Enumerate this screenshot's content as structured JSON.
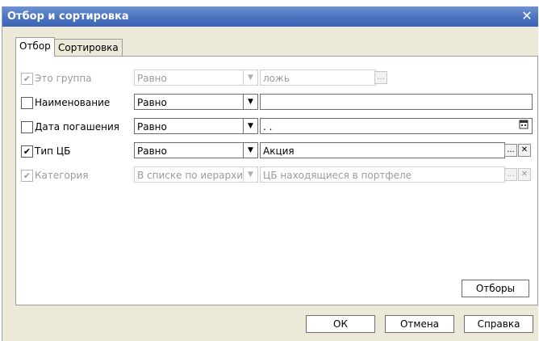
{
  "window": {
    "title": "Отбор и сортировка",
    "close_glyph": "✕"
  },
  "tabs": [
    {
      "label": "Отбор",
      "active": true
    },
    {
      "label": "Сортировка",
      "active": false
    }
  ],
  "filters": [
    {
      "label": "Это группа",
      "checked": true,
      "enabled": false,
      "condition": "Равно",
      "value": "ложь"
    },
    {
      "label": "Наименование",
      "checked": false,
      "enabled": true,
      "condition": "Равно",
      "value": ""
    },
    {
      "label": "Дата погашения",
      "checked": false,
      "enabled": true,
      "condition": "Равно",
      "value": " .  . "
    },
    {
      "label": "Тип ЦБ",
      "checked": true,
      "enabled": true,
      "condition": "Равно",
      "value": "Акция"
    },
    {
      "label": "Категория",
      "checked": true,
      "enabled": false,
      "condition": "В списке по иерархии",
      "value": "ЦБ находящиеся в портфеле"
    }
  ],
  "buttons": {
    "filters": "Отборы",
    "ok": "ОК",
    "cancel": "Отмена",
    "help": "Справка"
  },
  "glyphs": {
    "ellipsis": "...",
    "clear": "✕",
    "dropdown": "▼",
    "check": "✔"
  }
}
